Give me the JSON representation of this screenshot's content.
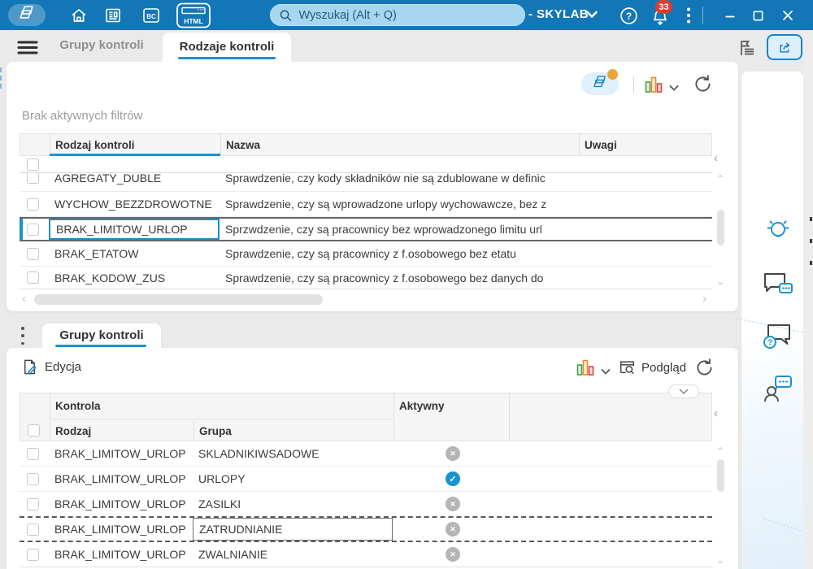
{
  "titlebar": {
    "search_placeholder": "Wyszukaj (Alt + Q)",
    "company_label": "- SKYLAB",
    "notifications_badge": "33",
    "bc_label": "BC",
    "html_label": "HTML"
  },
  "nav": {
    "tab_inactive": "Grupy kontroli",
    "tab_active": "Rodzaje kontroli"
  },
  "upper": {
    "filter_status": "Brak aktywnych filtrów",
    "columns": {
      "rodzaj": "Rodzaj kontroli",
      "nazwa": "Nazwa",
      "uwagi": "Uwagi"
    },
    "rows": [
      {
        "rodzaj": "AGREGATY_DUBLE",
        "nazwa": "Sprawdzenie, czy kody składników nie są zdublowane w definic"
      },
      {
        "rodzaj": "WYCHOW_BEZZDROWOTNE",
        "nazwa": "Sprawdzenie, czy są wprowadzone urlopy wychowawcze, bez z"
      },
      {
        "rodzaj": "BRAK_LIMITOW_URLOP",
        "nazwa": "Sprzwdzenie, czy są pracownicy bez wprowadzonego limitu url"
      },
      {
        "rodzaj": "BRAK_ETATOW",
        "nazwa": "Sprawdzenie, czy są pracownicy z f.osobowego bez etatu"
      },
      {
        "rodzaj": "BRAK_KODOW_ZUS",
        "nazwa": "Sprawdzenie, czy są pracownicy z f.osobowego bez danych do"
      }
    ]
  },
  "lower": {
    "tab": "Grupy kontroli",
    "edit_label": "Edycja",
    "preview_label": "Podgląd",
    "group_header": "Kontrola",
    "columns": {
      "rodzaj": "Rodzaj",
      "grupa": "Grupa",
      "aktywny": "Aktywny"
    },
    "rows": [
      {
        "rodzaj": "BRAK_LIMITOW_URLOP",
        "grupa": "SKLADNIKIWSADOWE",
        "aktywny": false
      },
      {
        "rodzaj": "BRAK_LIMITOW_URLOP",
        "grupa": "URLOPY",
        "aktywny": true
      },
      {
        "rodzaj": "BRAK_LIMITOW_URLOP",
        "grupa": "ZASILKI",
        "aktywny": false
      },
      {
        "rodzaj": "BRAK_LIMITOW_URLOP",
        "grupa": "ZATRUDNIANIE",
        "aktywny": false
      },
      {
        "rodzaj": "BRAK_LIMITOW_URLOP",
        "grupa": "ZWALNIANIE",
        "aktywny": false
      }
    ]
  },
  "colors": {
    "titlebar": "#1377b7",
    "accent": "#1792d2",
    "badge": "#e23b2e",
    "check_on": "#1b93d1",
    "check_off": "#b5b5b5",
    "chart_green": "#44a04a",
    "chart_orange": "#e78c2e",
    "chart_red": "#d64541"
  }
}
